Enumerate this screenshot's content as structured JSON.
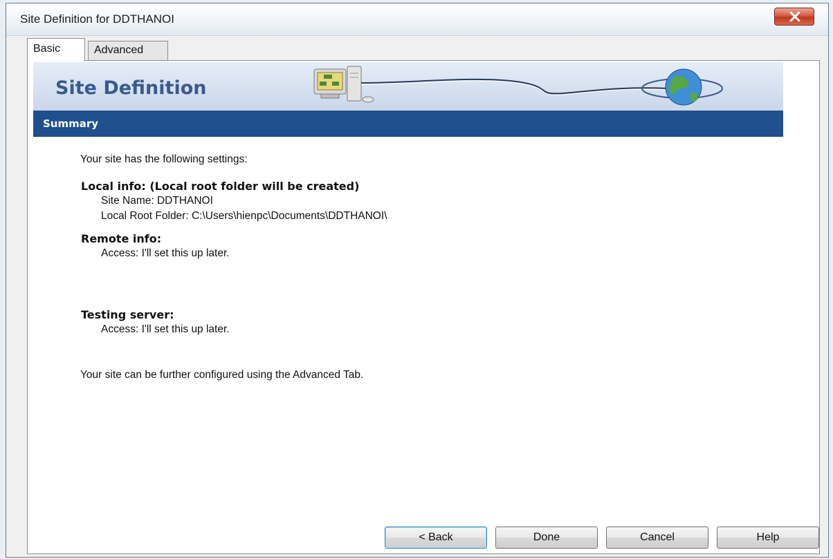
{
  "window": {
    "title": "Site Definition for DDTHANOI",
    "close_label": "close"
  },
  "tabs": [
    {
      "label": "Basic",
      "active": true
    },
    {
      "label": "Advanced",
      "active": false
    }
  ],
  "banner": {
    "title": "Site Definition",
    "icons": [
      "computer-icon",
      "globe-icon"
    ]
  },
  "section": {
    "title": "Summary"
  },
  "summary": {
    "intro": "Your site has the following settings:",
    "local_heading": "Local info: (Local root folder will be created)",
    "site_name": "Site Name: DDTHANOI",
    "local_root": "Local Root Folder: C:\\Users\\hienpc\\Documents\\DDTHANOI\\",
    "remote_heading": "Remote info:",
    "remote_access": "Access: I'll set this up later.",
    "testing_heading": "Testing server:",
    "testing_access": "Access: I'll set this up later.",
    "footer": "Your site can be further configured using the Advanced Tab."
  },
  "buttons": {
    "back": "< Back",
    "done": "Done",
    "cancel": "Cancel",
    "help": "Help"
  },
  "colors": {
    "summary_bar": "#1f4f8c",
    "banner_title": "#3a5a8f",
    "close_button": "#c0391f"
  }
}
